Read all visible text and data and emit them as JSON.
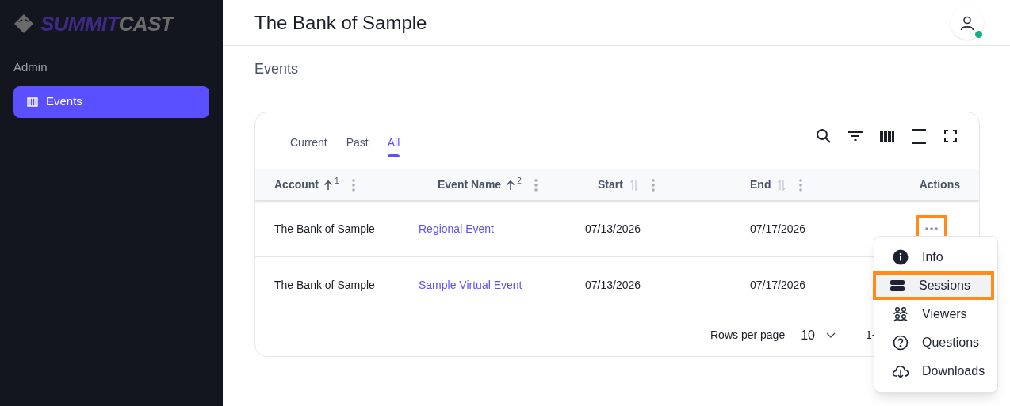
{
  "logo": {
    "primary": "SUMMIT",
    "secondary": "CAST"
  },
  "sidebar": {
    "section": "Admin",
    "items": [
      {
        "label": "Events",
        "selected": true
      }
    ]
  },
  "header": {
    "title": "The Bank of Sample",
    "user_online": true
  },
  "page_title": "Events",
  "tabs": [
    {
      "label": "Current",
      "selected": false
    },
    {
      "label": "Past",
      "selected": false
    },
    {
      "label": "All",
      "selected": true
    }
  ],
  "table": {
    "columns": [
      {
        "label": "Account",
        "sorted": true,
        "sort_index": "1"
      },
      {
        "label": "Event Name",
        "sorted": true,
        "sort_index": "2"
      },
      {
        "label": "Start",
        "sorted": false
      },
      {
        "label": "End",
        "sorted": false
      },
      {
        "label": "Actions"
      }
    ],
    "rows": [
      {
        "account": "The Bank of Sample",
        "event_name": "Regional Event",
        "start": "07/13/2026",
        "end": "07/17/2026",
        "actions_highlighted": true
      },
      {
        "account": "The Bank of Sample",
        "event_name": "Sample Virtual Event",
        "start": "07/13/2026",
        "end": "07/17/2026"
      }
    ]
  },
  "footer": {
    "rows_per_page_label": "Rows per page",
    "rows_per_page": "10",
    "range": "1-"
  },
  "action_menu": {
    "items": [
      {
        "kind": "info",
        "label": "Info",
        "highlighted": false
      },
      {
        "kind": "sessions",
        "label": "Sessions",
        "highlighted": true
      },
      {
        "kind": "viewers",
        "label": "Viewers",
        "highlighted": false
      },
      {
        "kind": "questions",
        "label": "Questions",
        "highlighted": false
      },
      {
        "kind": "downloads",
        "label": "Downloads",
        "highlighted": false
      }
    ]
  }
}
